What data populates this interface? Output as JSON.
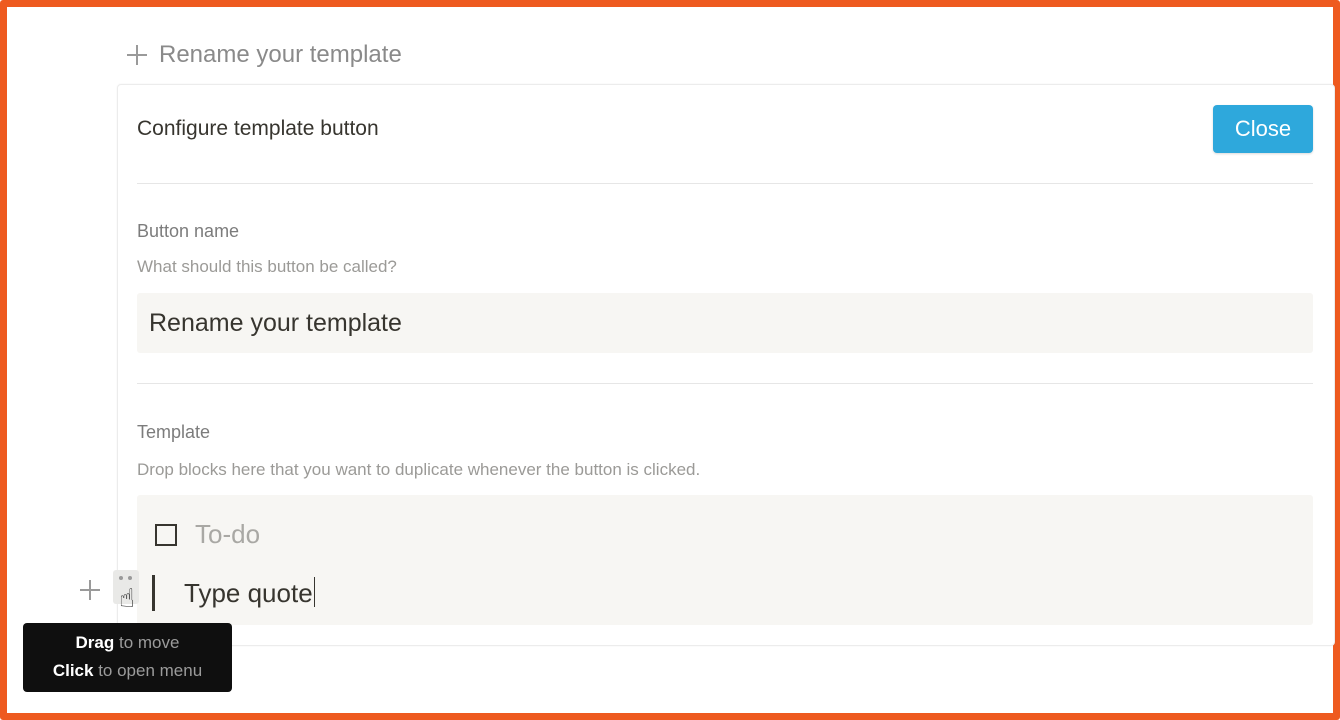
{
  "page": {
    "accent_color": "#2ea8dc",
    "frame_color": "#ee5a1f"
  },
  "template_button": {
    "icon": "plus-icon",
    "label": "Rename your template"
  },
  "panel": {
    "title": "Configure template button",
    "close_label": "Close",
    "button_name": {
      "label": "Button name",
      "description": "What should this button be called?",
      "value": "Rename your template"
    },
    "template": {
      "label": "Template",
      "description": "Drop blocks here that you want to duplicate whenever the button is clicked.",
      "todo_placeholder": "To-do",
      "quote_text": "Type quote"
    }
  },
  "block_controls": {
    "plus_icon": "plus-icon",
    "drag_icon": "drag-handle-icon",
    "cursor_icon": "hand-pointer-icon"
  },
  "tooltip": {
    "drag_bold": "Drag",
    "drag_rest": " to move",
    "click_bold": "Click",
    "click_rest": " to open menu"
  }
}
